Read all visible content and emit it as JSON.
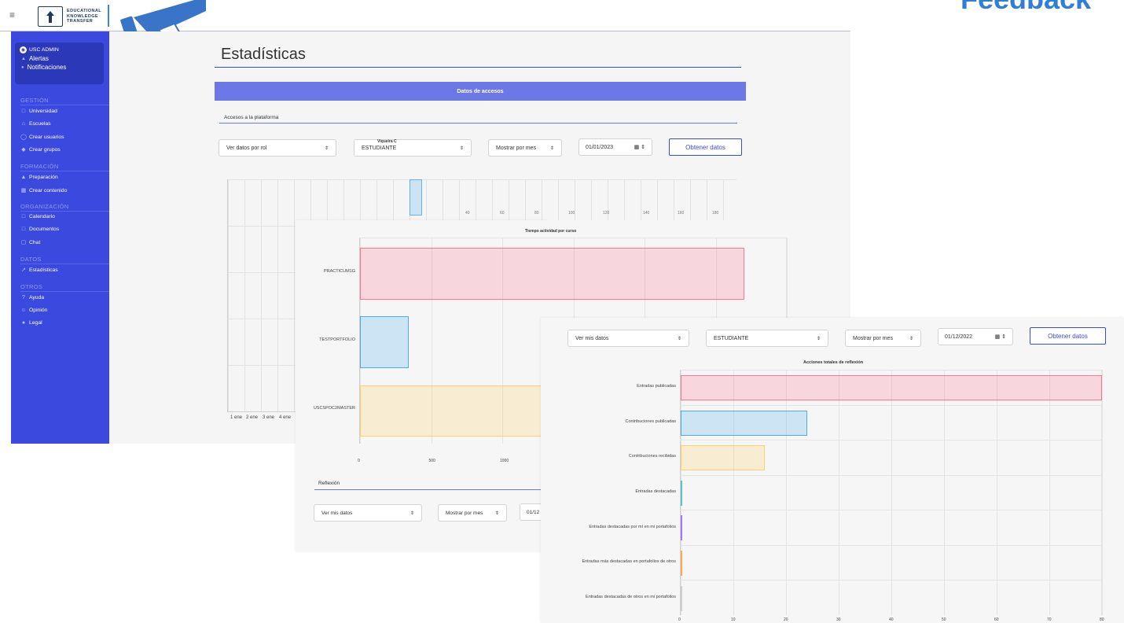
{
  "header": {
    "logo_line1": "EDUCATIONAL",
    "logo_line2": "KNOWLEDGE",
    "logo_line3": "TRANSFER",
    "corner_text": "Feedback"
  },
  "sidebar": {
    "user": "USC ADMIN",
    "alerts": "Alertas",
    "notifications": "Notificaciones",
    "sections": [
      {
        "title": "GESTIÓN",
        "items": [
          "Universidad",
          "Escuelas",
          "Crear usuarios",
          "Crear grupos"
        ]
      },
      {
        "title": "FORMACIÓN",
        "items": [
          "Preparación",
          "Crear contenido"
        ]
      },
      {
        "title": "ORGANIZACIÓN",
        "items": [
          "Calendario",
          "Documentos",
          "Chat"
        ]
      },
      {
        "title": "DATOS",
        "items": [
          "Estadísticas"
        ]
      },
      {
        "title": "OTROS",
        "items": [
          "Ayuda",
          "Opinión",
          "Legal"
        ]
      }
    ]
  },
  "main": {
    "title": "Estadísticas",
    "section_bar": "Datos de accesos",
    "access_subtitle": "Accesos a la plataforma",
    "filters1": {
      "role_select": "Ver datos por rol",
      "type_select": "ESTUDIANTE",
      "period_select": "Mostrar por mes",
      "date": "01/01/2023",
      "button": "Obtener datos"
    },
    "reflection_subtitle": "Reflexión",
    "filters2": {
      "view_select": "Ver mis datos",
      "period_select": "Mostrar por mes",
      "date_partial": "01/12"
    },
    "filters3": {
      "view_select": "Ver mis datos",
      "type_select": "ESTUDIANTE",
      "period_select": "Mostrar por mes",
      "date": "01/12/2022",
      "button": "Obtener datos"
    }
  },
  "colors": {
    "sidebar": "#3b49df",
    "accent": "#6b78e5",
    "pink": "#ff6384",
    "blue": "#36a2eb",
    "yellow": "#ffcd56"
  },
  "chart_data": [
    {
      "type": "line",
      "title": "Viqueira C",
      "x": [
        "1 ene",
        "2 ene",
        "3 ene",
        "4 ene"
      ],
      "partial_ticks": [
        "40",
        "60",
        "80",
        "100",
        "120",
        "140",
        "160",
        "180"
      ]
    },
    {
      "type": "bar",
      "orientation": "horizontal",
      "title": "Tiempo actividad por curso",
      "categories": [
        "PRACTICUM1G",
        "TESTPORTFOLIO",
        "USCSPOC2MASTER"
      ],
      "values": [
        2700,
        340,
        1300
      ],
      "ticks": [
        "0",
        "500",
        "1000"
      ],
      "xlim": [
        0,
        3000
      ]
    },
    {
      "type": "bar",
      "orientation": "horizontal",
      "title": "Acciones totales de reflexión",
      "categories": [
        "Entradas publicadas",
        "Contribuciones publicadas",
        "Contribuciones recibidas",
        "Entradas destacadas",
        "Entradas destacadas por mí en mi portafolios",
        "Entradas más destacadas en portafolios de otros",
        "Entradas destacadas de otros en mi portafolios"
      ],
      "values": [
        80,
        24,
        16,
        0,
        0,
        0,
        0
      ],
      "ticks": [
        "0",
        "10",
        "20",
        "30",
        "40",
        "50",
        "60",
        "70",
        "80"
      ],
      "xlim": [
        0,
        80
      ]
    }
  ]
}
